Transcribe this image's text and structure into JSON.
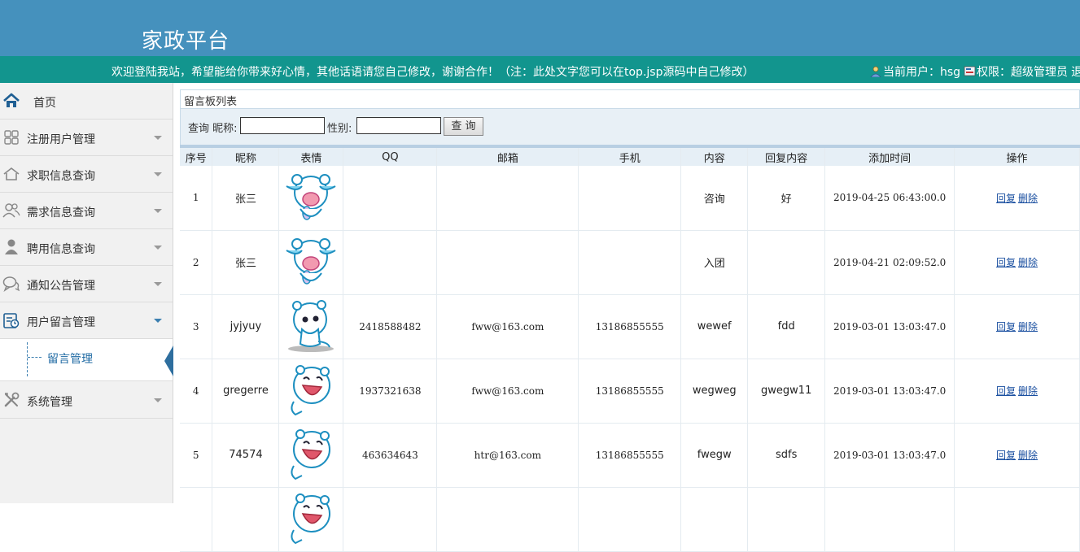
{
  "header": {
    "title": "家政平台",
    "welcome": "欢迎登陆我站，希望能给你带来好心情，其他话语请您自己修改，谢谢合作！（注：此处文字您可以在top.jsp源码中自己修改）",
    "current_user_label": "当前用户：hsg",
    "role_label": "权限：超级管理员",
    "logout_partial": "退"
  },
  "sidebar": {
    "items": [
      {
        "label": "首页",
        "icon": "home-icon"
      },
      {
        "label": "注册用户管理",
        "icon": "grid-icon"
      },
      {
        "label": "求职信息查询",
        "icon": "house-icon"
      },
      {
        "label": "需求信息查询",
        "icon": "users-icon"
      },
      {
        "label": "聘用信息查询",
        "icon": "person-icon"
      },
      {
        "label": "通知公告管理",
        "icon": "chat-icon"
      },
      {
        "label": "用户留言管理",
        "icon": "message-board-icon"
      },
      {
        "label": "系统管理",
        "icon": "tools-icon"
      }
    ],
    "sub_items": [
      {
        "label": "留言管理"
      }
    ]
  },
  "panel": {
    "title": "留言板列表"
  },
  "search": {
    "nickname_label": "查询 昵称:",
    "nickname_value": "",
    "gender_label": "性别:",
    "gender_value": "",
    "button_label": "查 询"
  },
  "table": {
    "headers": [
      "序号",
      "昵称",
      "表情",
      "QQ",
      "邮箱",
      "手机",
      "内容",
      "回复内容",
      "添加时间",
      "操作"
    ],
    "reply_label": "回复",
    "delete_label": "删除",
    "rows": [
      {
        "no": "1",
        "nickname": "张三",
        "face": "crying-bear-face-icon",
        "qq": "",
        "email": "",
        "phone": "",
        "content": "咨询",
        "reply": "好",
        "time": "2019-04-25 06:43:00.0"
      },
      {
        "no": "2",
        "nickname": "张三",
        "face": "crying-bear-face-icon",
        "qq": "",
        "email": "",
        "phone": "",
        "content": "入团",
        "reply": "",
        "time": "2019-04-21 02:09:52.0"
      },
      {
        "no": "3",
        "nickname": "jyjyuy",
        "face": "thinking-bear-face-icon",
        "qq": "2418588482",
        "email": "fww@163.com",
        "phone": "13186855555",
        "content": "wewef",
        "reply": "fdd",
        "time": "2019-03-01 13:03:47.0"
      },
      {
        "no": "4",
        "nickname": "gregerre",
        "face": "laughing-bear-face-icon",
        "qq": "1937321638",
        "email": "fww@163.com",
        "phone": "13186855555",
        "content": "wegweg",
        "reply": "gwegw11",
        "time": "2019-03-01 13:03:47.0"
      },
      {
        "no": "5",
        "nickname": "74574",
        "face": "laughing-bear-face-icon",
        "qq": "463634643",
        "email": "htr@163.com",
        "phone": "13186855555",
        "content": "fwegw",
        "reply": "sdfs",
        "time": "2019-03-01 13:03:47.0"
      },
      {
        "no": "",
        "nickname": "",
        "face": "laughing-bear-face-icon",
        "qq": "",
        "email": "",
        "phone": "",
        "content": "",
        "reply": "",
        "time": ""
      }
    ]
  },
  "colors": {
    "header_bg": "#4591bd",
    "infobar_bg": "#12958e",
    "link": "#1a4fa0",
    "sidebar_bg": "#f1f1f1"
  }
}
